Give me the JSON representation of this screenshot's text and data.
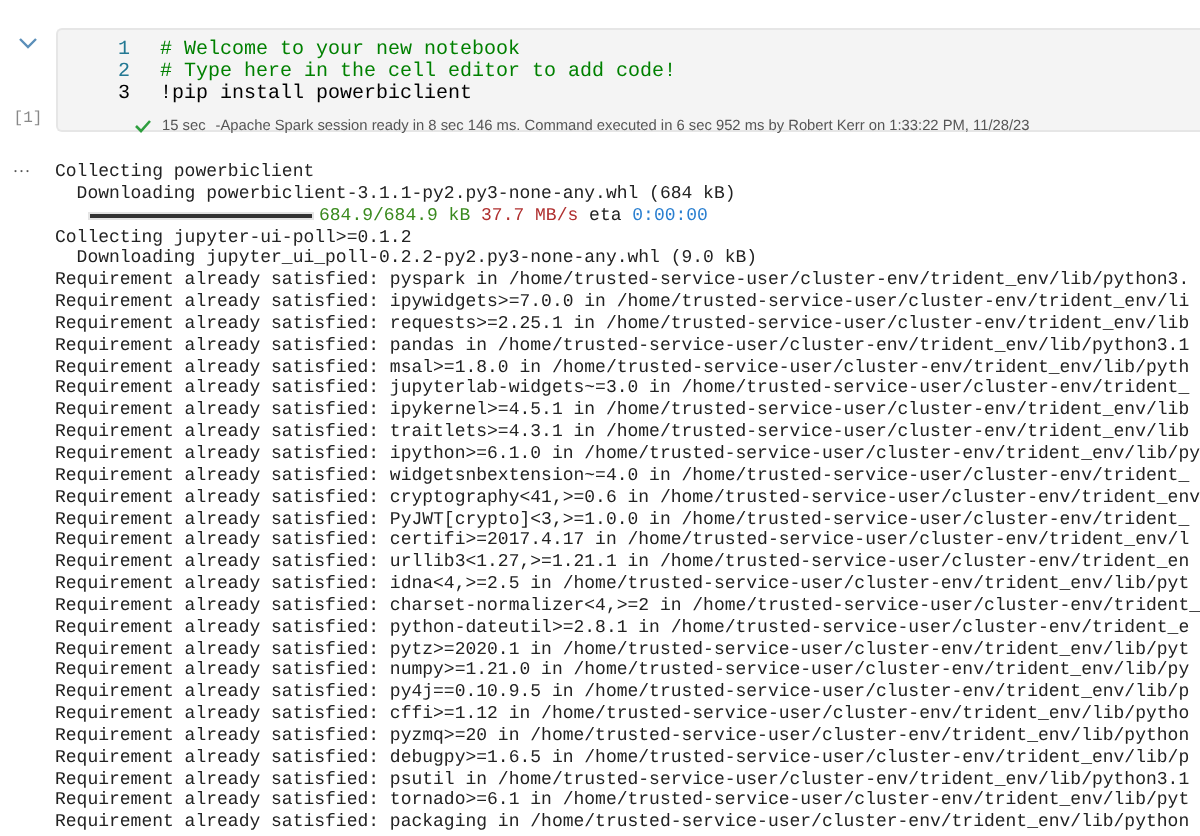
{
  "cell": {
    "expanded": true,
    "code_lines": [
      {
        "number": "1",
        "text": "# Welcome to your new notebook",
        "kind": "comment",
        "current": false
      },
      {
        "number": "2",
        "text": "# Type here in the cell editor to add code!",
        "kind": "comment",
        "current": false
      },
      {
        "number": "3",
        "text": "!pip install powerbiclient",
        "kind": "code",
        "current": true
      }
    ],
    "execution_count": "[1]",
    "status": {
      "succeeded": true,
      "duration": "15 sec",
      "message": "-Apache Spark session ready in 8 sec 146 ms. Command executed in 6 sec 952 ms by Robert Kerr on 1:33:22 PM, 11/28/23"
    }
  },
  "output": {
    "more": "···",
    "lines": [
      {
        "kind": "text",
        "text": "Collecting powerbiclient"
      },
      {
        "kind": "text",
        "text": "  Downloading powerbiclient-3.1.1-py2.py3-none-any.whl (684 kB)"
      },
      {
        "kind": "progress",
        "level": 1.0,
        "size": "684.9/684.9 kB",
        "speed": "37.7 MB/s",
        "eta_label": "eta",
        "eta": "0:00:00"
      },
      {
        "kind": "text",
        "text": "Collecting jupyter-ui-poll>=0.1.2"
      },
      {
        "kind": "text",
        "text": "  Downloading jupyter_ui_poll-0.2.2-py2.py3-none-any.whl (9.0 kB)"
      },
      {
        "kind": "text",
        "text": "Requirement already satisfied: pyspark in /home/trusted-service-user/cluster-env/trident_env/lib/python3."
      },
      {
        "kind": "text",
        "text": "Requirement already satisfied: ipywidgets>=7.0.0 in /home/trusted-service-user/cluster-env/trident_env/li"
      },
      {
        "kind": "text",
        "text": "Requirement already satisfied: requests>=2.25.1 in /home/trusted-service-user/cluster-env/trident_env/lib"
      },
      {
        "kind": "text",
        "text": "Requirement already satisfied: pandas in /home/trusted-service-user/cluster-env/trident_env/lib/python3.1"
      },
      {
        "kind": "text",
        "text": "Requirement already satisfied: msal>=1.8.0 in /home/trusted-service-user/cluster-env/trident_env/lib/pyth"
      },
      {
        "kind": "text",
        "text": "Requirement already satisfied: jupyterlab-widgets~=3.0 in /home/trusted-service-user/cluster-env/trident_"
      },
      {
        "kind": "text",
        "text": "Requirement already satisfied: ipykernel>=4.5.1 in /home/trusted-service-user/cluster-env/trident_env/lib"
      },
      {
        "kind": "text",
        "text": "Requirement already satisfied: traitlets>=4.3.1 in /home/trusted-service-user/cluster-env/trident_env/lib"
      },
      {
        "kind": "text",
        "text": "Requirement already satisfied: ipython>=6.1.0 in /home/trusted-service-user/cluster-env/trident_env/lib/py"
      },
      {
        "kind": "text",
        "text": "Requirement already satisfied: widgetsnbextension~=4.0 in /home/trusted-service-user/cluster-env/trident_"
      },
      {
        "kind": "text",
        "text": "Requirement already satisfied: cryptography<41,>=0.6 in /home/trusted-service-user/cluster-env/trident_env"
      },
      {
        "kind": "text",
        "text": "Requirement already satisfied: PyJWT[crypto]<3,>=1.0.0 in /home/trusted-service-user/cluster-env/trident_"
      },
      {
        "kind": "text",
        "text": "Requirement already satisfied: certifi>=2017.4.17 in /home/trusted-service-user/cluster-env/trident_env/l"
      },
      {
        "kind": "text",
        "text": "Requirement already satisfied: urllib3<1.27,>=1.21.1 in /home/trusted-service-user/cluster-env/trident_en"
      },
      {
        "kind": "text",
        "text": "Requirement already satisfied: idna<4,>=2.5 in /home/trusted-service-user/cluster-env/trident_env/lib/pyt"
      },
      {
        "kind": "text",
        "text": "Requirement already satisfied: charset-normalizer<4,>=2 in /home/trusted-service-user/cluster-env/trident_"
      },
      {
        "kind": "text",
        "text": "Requirement already satisfied: python-dateutil>=2.8.1 in /home/trusted-service-user/cluster-env/trident_e"
      },
      {
        "kind": "text",
        "text": "Requirement already satisfied: pytz>=2020.1 in /home/trusted-service-user/cluster-env/trident_env/lib/pyt"
      },
      {
        "kind": "text",
        "text": "Requirement already satisfied: numpy>=1.21.0 in /home/trusted-service-user/cluster-env/trident_env/lib/py"
      },
      {
        "kind": "text",
        "text": "Requirement already satisfied: py4j==0.10.9.5 in /home/trusted-service-user/cluster-env/trident_env/lib/p"
      },
      {
        "kind": "text",
        "text": "Requirement already satisfied: cffi>=1.12 in /home/trusted-service-user/cluster-env/trident_env/lib/pytho"
      },
      {
        "kind": "text",
        "text": "Requirement already satisfied: pyzmq>=20 in /home/trusted-service-user/cluster-env/trident_env/lib/python"
      },
      {
        "kind": "text",
        "text": "Requirement already satisfied: debugpy>=1.6.5 in /home/trusted-service-user/cluster-env/trident_env/lib/p"
      },
      {
        "kind": "text",
        "text": "Requirement already satisfied: psutil in /home/trusted-service-user/cluster-env/trident_env/lib/python3.1"
      },
      {
        "kind": "text",
        "text": "Requirement already satisfied: tornado>=6.1 in /home/trusted-service-user/cluster-env/trident_env/lib/pyt"
      },
      {
        "kind": "text",
        "text": "Requirement already satisfied: packaging in /home/trusted-service-user/cluster-env/trident_env/lib/python"
      }
    ]
  }
}
